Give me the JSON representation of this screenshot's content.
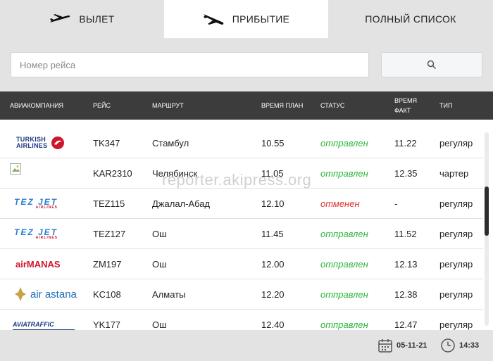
{
  "tabs": [
    {
      "label": "ВЫЛЕТ",
      "icon": "plane-departure-icon"
    },
    {
      "label": "ПРИБЫТИЕ",
      "icon": "plane-arrival-icon"
    },
    {
      "label": "ПОЛНЫЙ СПИСОК"
    }
  ],
  "search": {
    "placeholder": "Номер рейса",
    "value": "",
    "button_icon": "search-icon"
  },
  "table": {
    "headers": {
      "airline": "АВИАКОМПАНИЯ",
      "flight": "РЕЙС",
      "route": "МАРШРУТ",
      "planned": "ВРЕМЯ ПЛАН",
      "status": "СТАТУС",
      "actual_1": "ВРЕМЯ",
      "actual_2": "ФАКТ",
      "type": "ТИП"
    },
    "rows": [
      {
        "airline_logo": "TURKISH AIRLINES",
        "logo_line1": "TURKISH",
        "logo_line2": "AIRLINES",
        "flight": "TK347",
        "route": "Стамбул",
        "planned": "10.55",
        "status": "отправлен",
        "actual": "11.22",
        "type": "регуляр"
      },
      {
        "airline_logo": "",
        "flight": "KAR2310",
        "route": "Челябинск",
        "planned": "11.05",
        "status": "отправлен",
        "actual": "12.35",
        "type": "чартер"
      },
      {
        "airline_logo": "TEZ JET",
        "logo_line1": "TEZ JET",
        "logo_line2": "AIRLINES",
        "flight": "TEZ115",
        "route": "Джалал-Абад",
        "planned": "12.10",
        "status": "отменен",
        "actual": "-",
        "type": "регуляр"
      },
      {
        "airline_logo": "TEZ JET",
        "logo_line1": "TEZ JET",
        "logo_line2": "AIRLINES",
        "flight": "TEZ127",
        "route": "Ош",
        "planned": "11.45",
        "status": "отправлен",
        "actual": "11.52",
        "type": "регуляр"
      },
      {
        "airline_logo": "airMANAS",
        "flight": "ZM197",
        "route": "Ош",
        "planned": "12.00",
        "status": "отправлен",
        "actual": "12.13",
        "type": "регуляр"
      },
      {
        "airline_logo": "air astana",
        "flight": "KC108",
        "route": "Алматы",
        "planned": "12.20",
        "status": "отправлен",
        "actual": "12.38",
        "type": "регуляр"
      },
      {
        "airline_logo": "AVIATRAFFIC",
        "flight": "YK177",
        "route": "Ош",
        "planned": "12.40",
        "status": "отправлен",
        "actual": "12.47",
        "type": "регуляр"
      }
    ]
  },
  "watermark": "reporter.akipress.org",
  "footer": {
    "date": "05-11-21",
    "time": "14:33",
    "date_icon": "calendar-icon",
    "time_icon": "clock-icon"
  },
  "colors": {
    "status_ok": "#2bb53a",
    "status_cancel": "#e13232",
    "header_bg": "#3c3c3c",
    "panel_bg": "#e3e3e3"
  }
}
